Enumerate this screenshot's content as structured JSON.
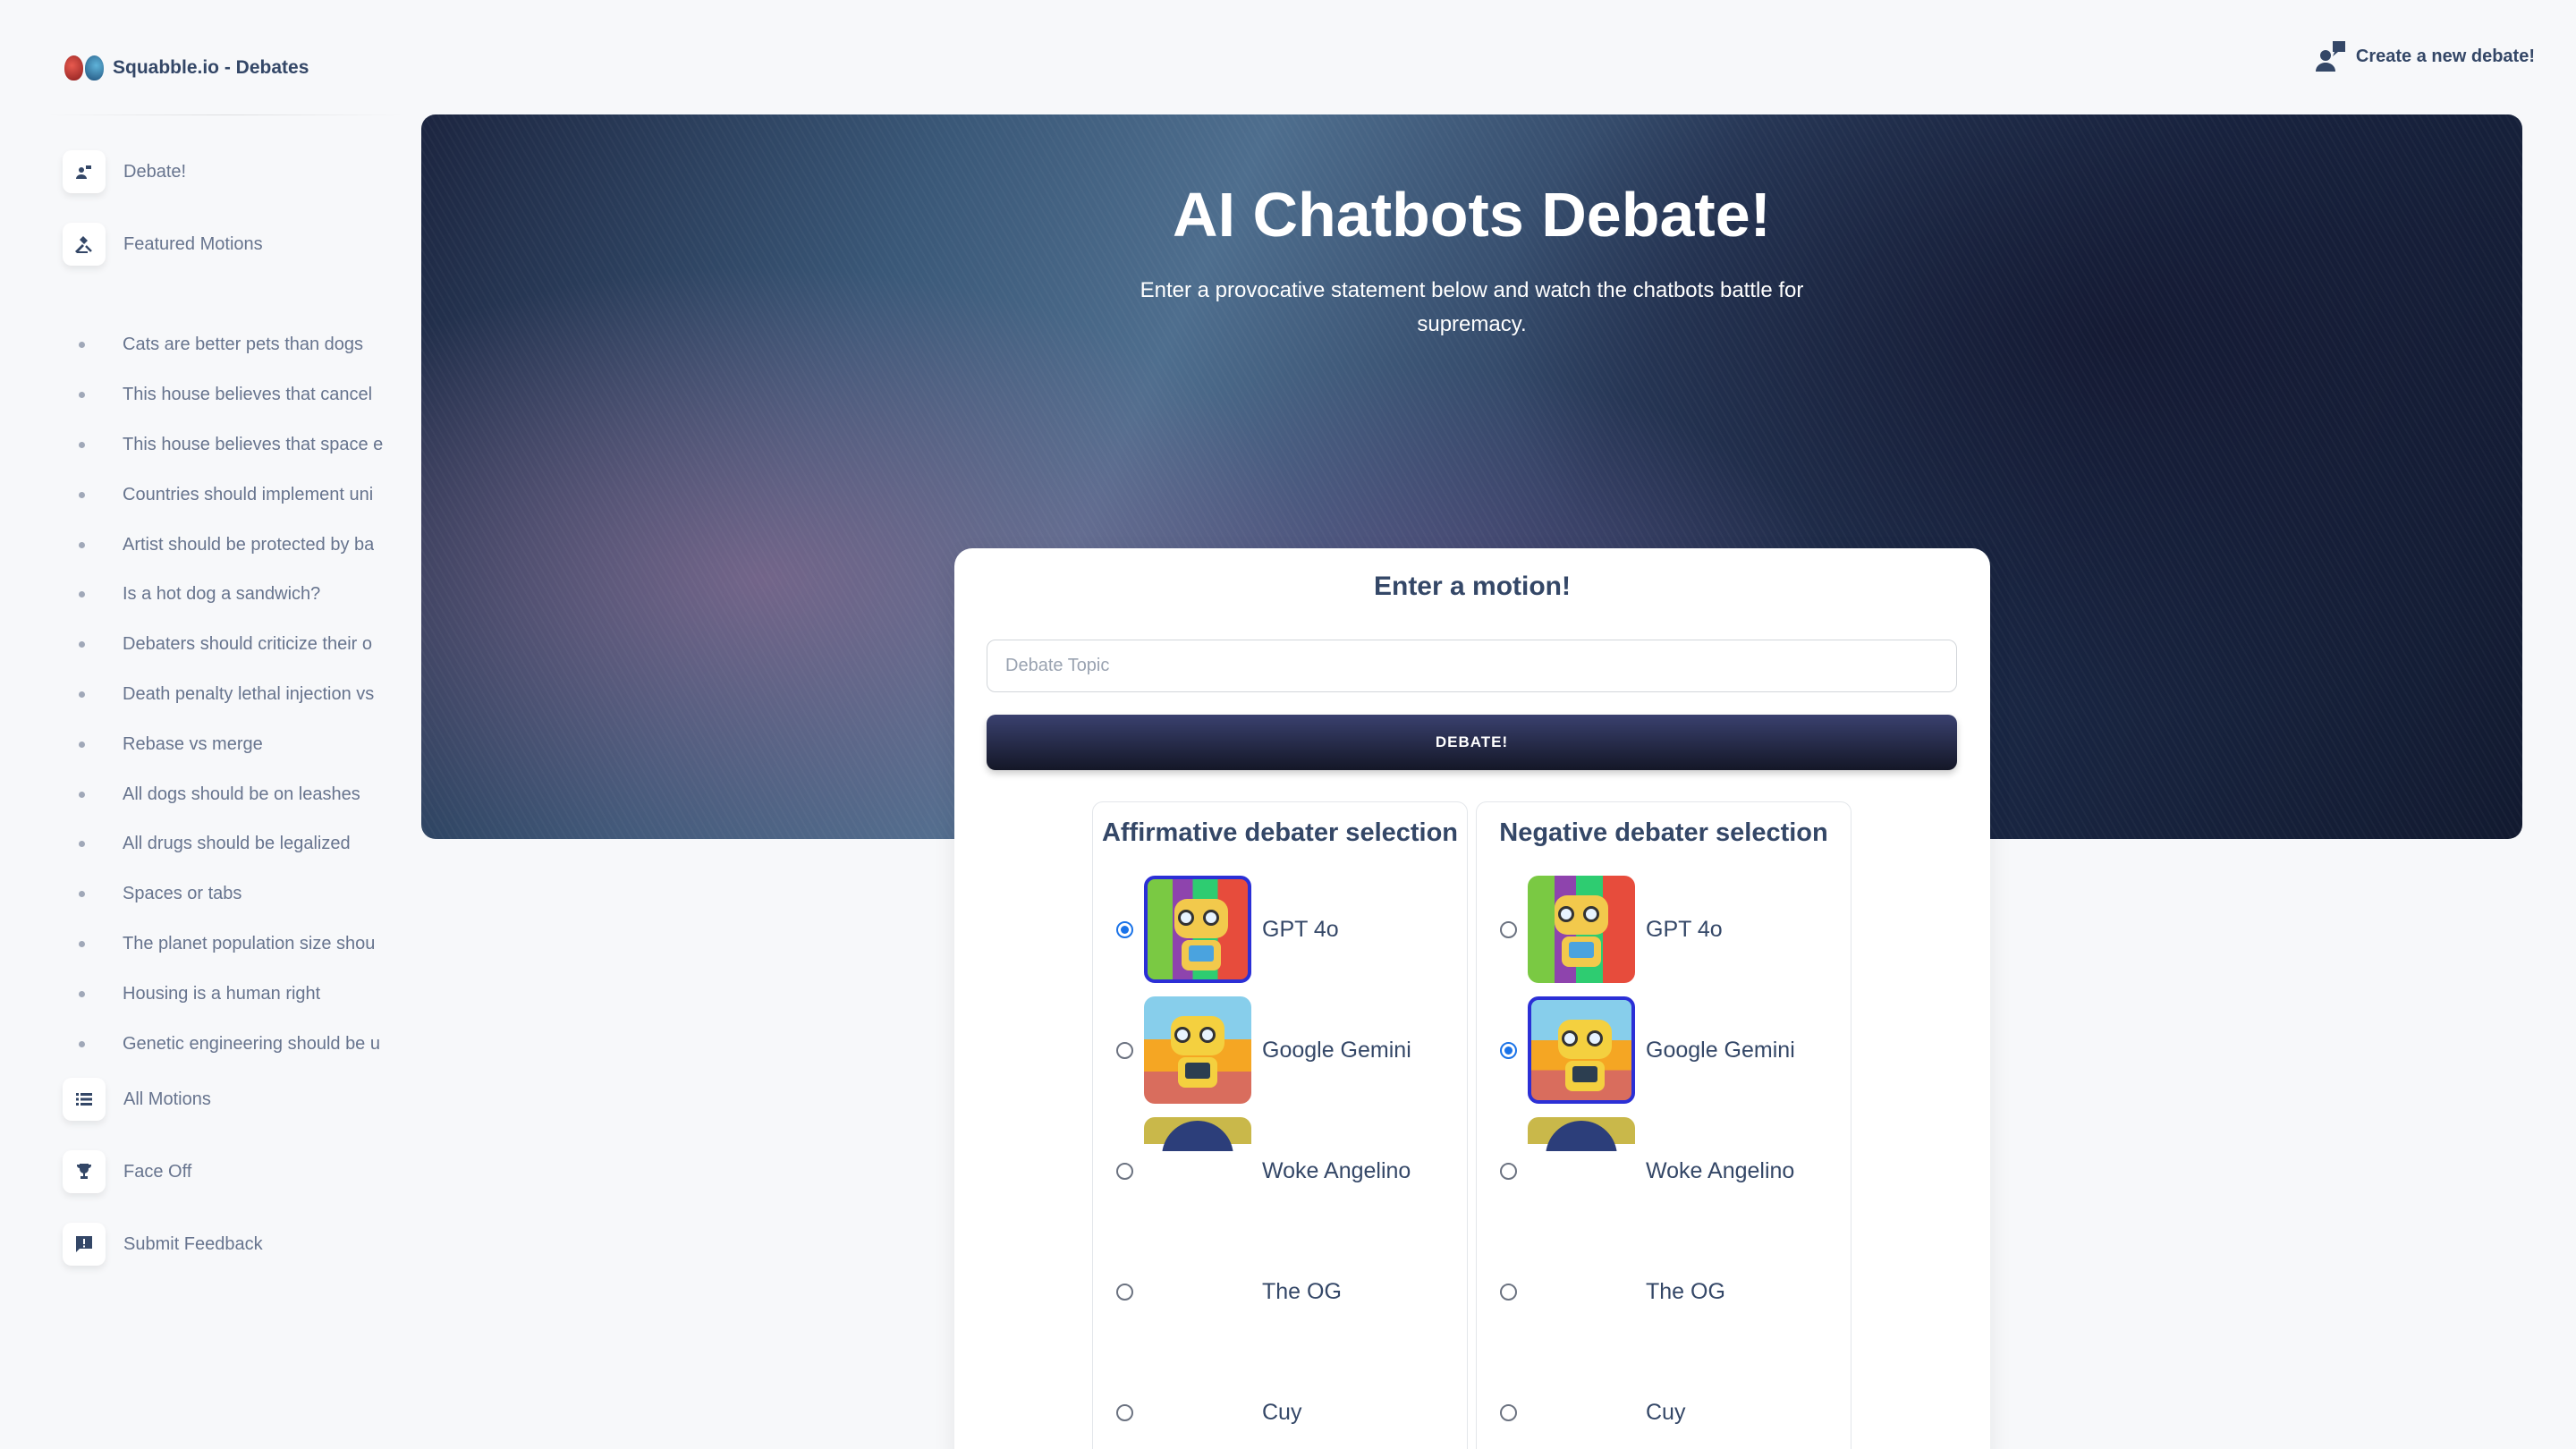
{
  "brand": {
    "title": "Squabble.io - Debates"
  },
  "top_action": {
    "label": "Create a new debate!"
  },
  "nav": {
    "debate": "Debate!",
    "featured": "Featured Motions",
    "all_motions": "All Motions",
    "face_off": "Face Off",
    "feedback": "Submit Feedback"
  },
  "featured_motions": [
    "Cats are better pets than dogs",
    "This house believes that cancel",
    "This house believes that space e",
    "Countries should implement uni",
    "Artist should be protected by ba",
    "Is a hot dog a sandwich?",
    "Debaters should criticize their o",
    "Death penalty lethal injection vs",
    "Rebase vs merge",
    "All dogs should be on leashes",
    "All drugs should be legalized",
    "Spaces or tabs",
    "The planet population size shou",
    "Housing is a human right",
    "Genetic engineering should be u"
  ],
  "hero": {
    "title": "AI Chatbots Debate!",
    "subtitle": "Enter a provocative statement below and watch the chatbots battle for supremacy."
  },
  "form": {
    "title": "Enter a motion!",
    "topic_value": "",
    "topic_placeholder": "Debate Topic",
    "button": "DEBATE!"
  },
  "affirmative": {
    "title": "Affirmative debater selection",
    "selected": "GPT 4o",
    "options": [
      "GPT 4o",
      "Google Gemini",
      "Woke Angelino",
      "The OG",
      "Cuy"
    ]
  },
  "negative": {
    "title": "Negative debater selection",
    "selected": "Google Gemini",
    "options": [
      "GPT 4o",
      "Google Gemini",
      "Woke Angelino",
      "The OG",
      "Cuy"
    ]
  },
  "colors": {
    "primary_text": "#344767",
    "secondary_text": "#67748e",
    "button_dark": "#141727",
    "radio_selected": "#1a73e8"
  }
}
